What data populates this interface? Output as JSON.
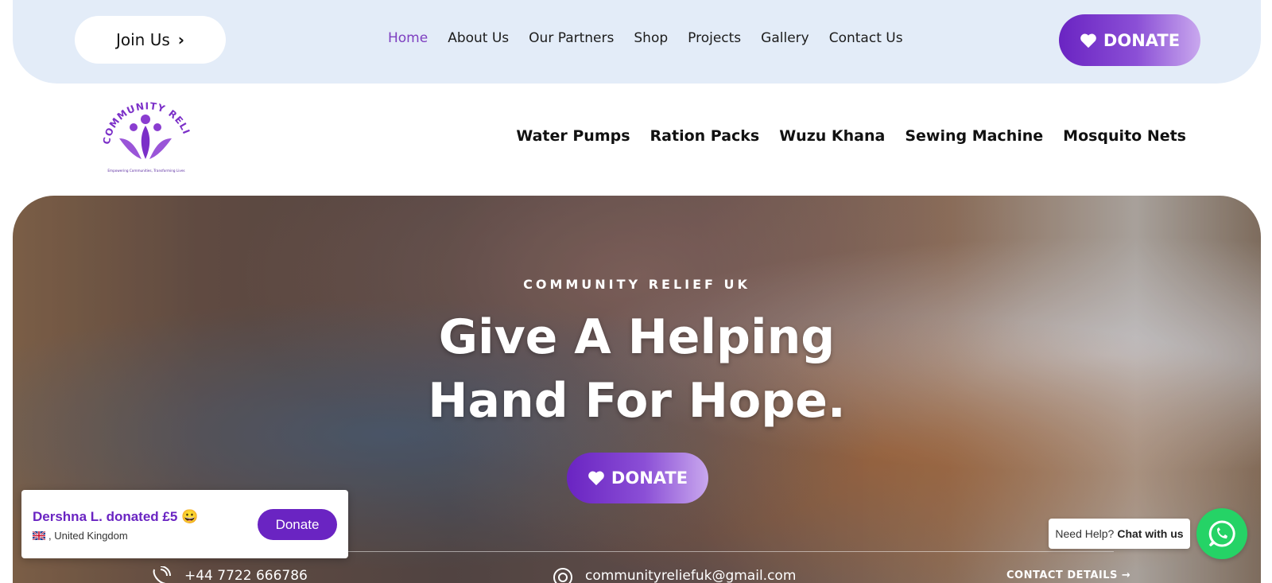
{
  "topbar": {
    "join_label": "Join Us",
    "nav": [
      {
        "label": "Home",
        "active": true
      },
      {
        "label": "About Us"
      },
      {
        "label": "Our Partners"
      },
      {
        "label": "Shop"
      },
      {
        "label": "Projects"
      },
      {
        "label": "Gallery"
      },
      {
        "label": "Contact Us"
      }
    ],
    "donate_label": "DONATE"
  },
  "logo": {
    "name": "COMMUNITY RELIEF UK",
    "tagline": "Empowering Communities, Transforming Lives"
  },
  "category_nav": [
    "Water Pumps",
    "Ration Packs",
    "Wuzu Khana",
    "Sewing Machine",
    "Mosquito Nets"
  ],
  "hero": {
    "kicker": "COMMUNITY RELIEF UK",
    "title_line1": "Give A Helping",
    "title_line2": "Hand For Hope.",
    "donate_label": "DONATE",
    "phone": "+44 7722 666786",
    "email": "communityreliefuk@gmail.com",
    "contact_details_label": "CONTACT DETAILS →"
  },
  "toast": {
    "title": "Dershna L. donated £5 😀",
    "location": ", United Kingdom",
    "button_label": "Donate"
  },
  "whatsapp": {
    "help_prefix": "Need Help?",
    "help_action": "Chat with us"
  },
  "colors": {
    "brand_purple": "#6a24c2",
    "topbar_bg": "#e3ecf8",
    "whatsapp_green": "#25d366"
  }
}
